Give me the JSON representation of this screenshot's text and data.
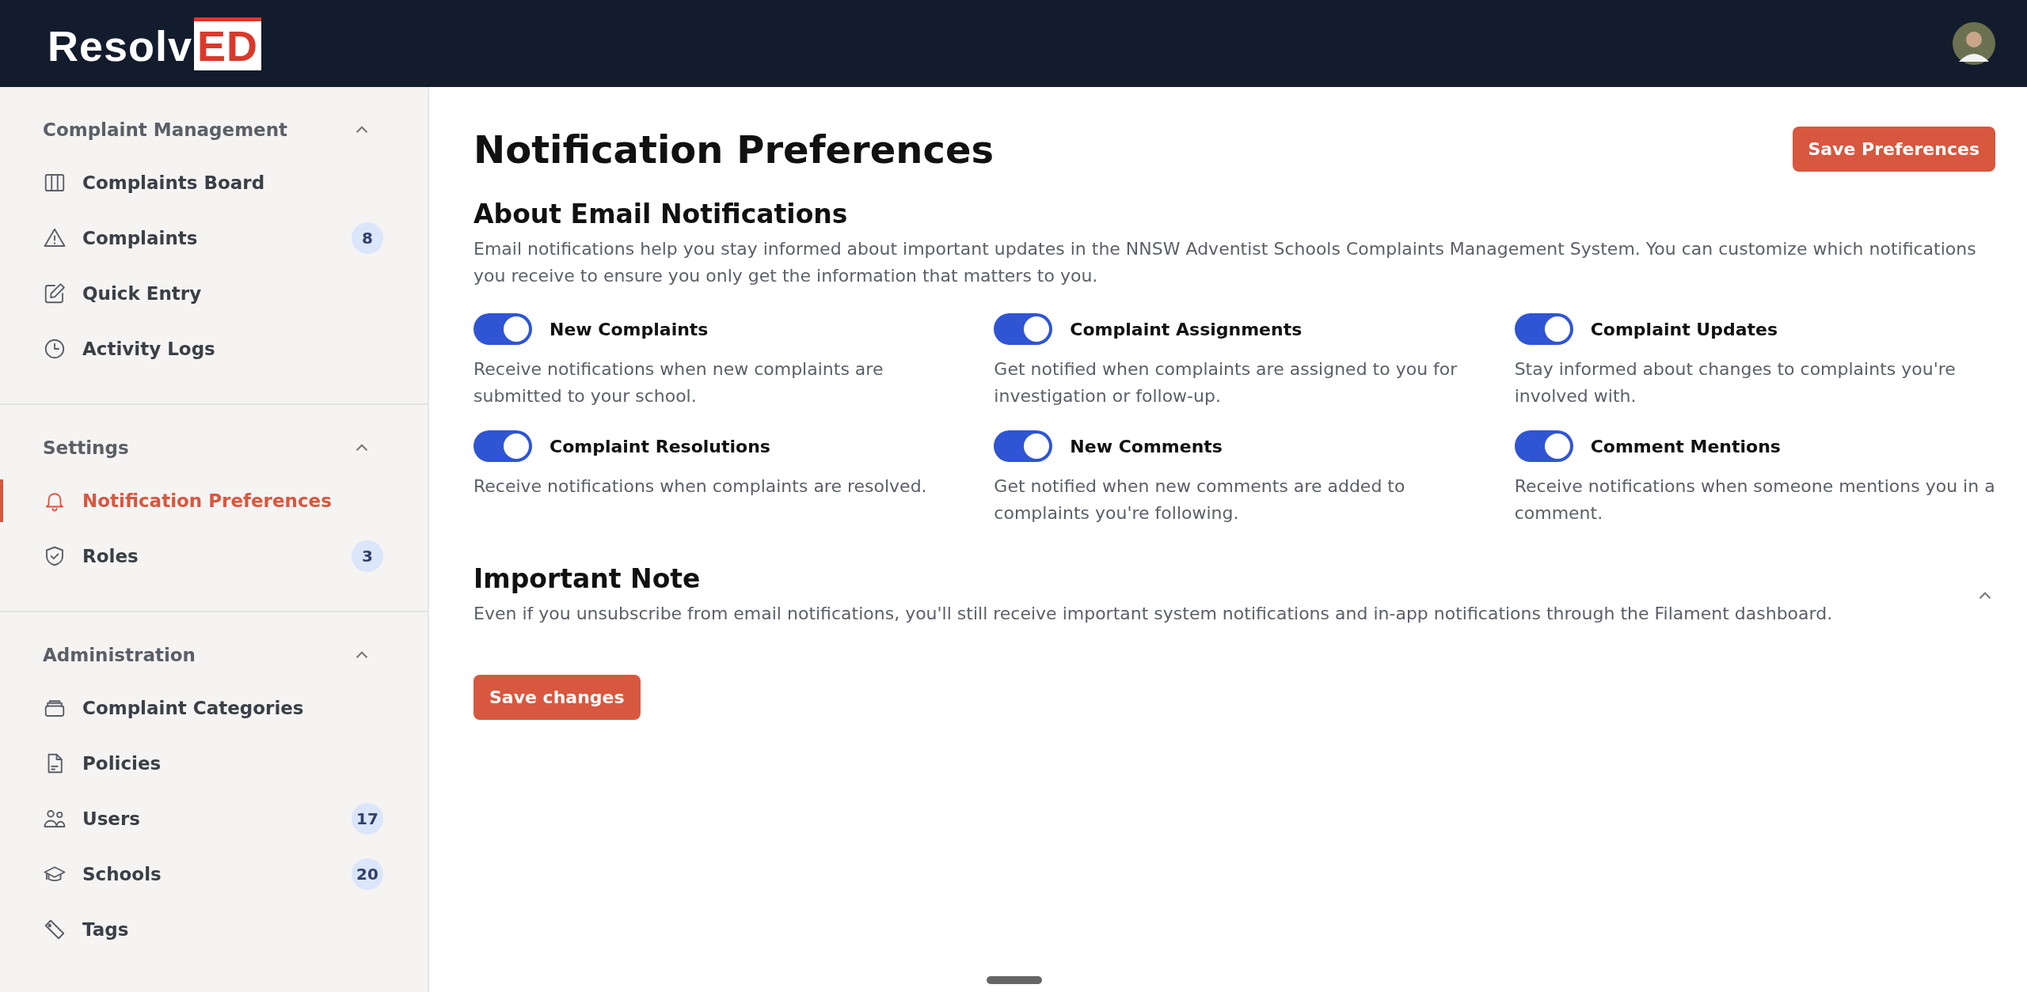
{
  "header": {
    "logo": {
      "text": "Resolv",
      "accent": "ED"
    }
  },
  "sidebar": {
    "groups": [
      {
        "label": "Complaint Management",
        "expanded": true,
        "items": [
          {
            "label": "Complaints Board",
            "kind": "board",
            "selected": false
          },
          {
            "label": "Complaints",
            "kind": "warning",
            "badge": "8",
            "selected": false
          },
          {
            "label": "Quick Entry",
            "kind": "edit",
            "selected": false
          },
          {
            "label": "Activity Logs",
            "kind": "clock",
            "selected": false
          }
        ]
      },
      {
        "label": "Settings",
        "expanded": true,
        "items": [
          {
            "label": "Notification Preferences",
            "kind": "bell",
            "selected": true
          },
          {
            "label": "Roles",
            "kind": "shield",
            "badge": "3",
            "selected": false
          }
        ]
      },
      {
        "label": "Administration",
        "expanded": true,
        "items": [
          {
            "label": "Complaint Categories",
            "kind": "stack",
            "selected": false
          },
          {
            "label": "Policies",
            "kind": "doc",
            "selected": false
          },
          {
            "label": "Users",
            "kind": "users",
            "badge": "17",
            "selected": false
          },
          {
            "label": "Schools",
            "kind": "cap",
            "badge": "20",
            "selected": false
          },
          {
            "label": "Tags",
            "kind": "tag",
            "selected": false
          }
        ]
      }
    ]
  },
  "page": {
    "title": "Notification Preferences",
    "save_button": "Save Preferences",
    "about": {
      "heading": "About Email Notifications",
      "text": "Email notifications help you stay informed about important updates in the NNSW Adventist Schools Complaints Management System. You can customize which notifications you receive to ensure you only get the information that matters to you."
    },
    "toggles": [
      {
        "label": "New Complaints",
        "on": true,
        "description": "Receive notifications when new complaints are submitted to your school."
      },
      {
        "label": "Complaint Assignments",
        "on": true,
        "description": "Get notified when complaints are assigned to you for investigation or follow-up."
      },
      {
        "label": "Complaint Updates",
        "on": true,
        "description": "Stay informed about changes to complaints you're involved with."
      },
      {
        "label": "Complaint Resolutions",
        "on": true,
        "description": "Receive notifications when complaints are resolved."
      },
      {
        "label": "New Comments",
        "on": true,
        "description": "Get notified when new comments are added to complaints you're following."
      },
      {
        "label": "Comment Mentions",
        "on": true,
        "description": "Receive notifications when someone mentions you in a comment."
      }
    ],
    "note": {
      "heading": "Important Note",
      "expanded": true,
      "text": "Even if you unsubscribe from email notifications, you'll still receive important system notifications and in-app notifications through the Filament dashboard."
    },
    "submit_button": "Save changes"
  }
}
